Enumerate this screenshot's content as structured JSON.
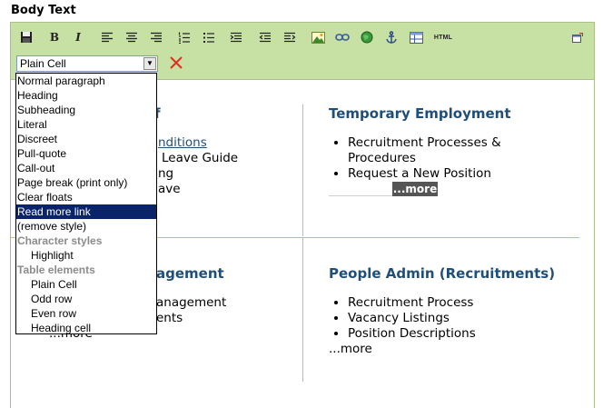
{
  "field_label": "Body Text",
  "toolbar": {
    "buttons": [
      "save-icon",
      "bold",
      "italic",
      "align-left-icon",
      "align-center-icon",
      "align-right-icon",
      "numbered-list-icon",
      "bulleted-list-icon",
      "outdent-icon",
      "indent-left-icon",
      "indent-right-icon",
      "insert-image-icon",
      "link-icon",
      "web-link-icon",
      "anchor-icon",
      "table-icon",
      "html-source",
      "maximize-icon"
    ],
    "bold_label": "B",
    "italic_label": "I",
    "html_label": "HTML",
    "style_select_value": "Plain Cell"
  },
  "dropdown": {
    "options": [
      {
        "label": "Normal paragraph",
        "kind": "item"
      },
      {
        "label": "Heading",
        "kind": "item"
      },
      {
        "label": "Subheading",
        "kind": "item"
      },
      {
        "label": "Literal",
        "kind": "item"
      },
      {
        "label": "Discreet",
        "kind": "item"
      },
      {
        "label": "Pull-quote",
        "kind": "item"
      },
      {
        "label": "Call-out",
        "kind": "item"
      },
      {
        "label": "Page break (print only)",
        "kind": "item"
      },
      {
        "label": "Clear floats",
        "kind": "item"
      },
      {
        "label": "Read more link",
        "kind": "item",
        "selected": true
      },
      {
        "label": "(remove style)",
        "kind": "item"
      },
      {
        "label": "Character styles",
        "kind": "group"
      },
      {
        "label": "Highlight",
        "kind": "item",
        "indent": true
      },
      {
        "label": "Table elements",
        "kind": "group"
      },
      {
        "label": "Plain Cell",
        "kind": "item",
        "indent": true
      },
      {
        "label": "Odd row",
        "kind": "item",
        "indent": true
      },
      {
        "label": "Even row",
        "kind": "item",
        "indent": true
      },
      {
        "label": "Heading cell",
        "kind": "item",
        "indent": true
      }
    ]
  },
  "content": {
    "left_top": {
      "title_fragment": "f",
      "line1": "nditions",
      "line2": "Leave Guide",
      "line3": "ng",
      "line4": "ave"
    },
    "right_top": {
      "title": "Temporary Employment",
      "items": [
        "Recruitment Processes &",
        "Procedures",
        "Request a New Position"
      ],
      "more": "...more"
    },
    "left_bottom": {
      "title_fragment": "agement",
      "line1": "anagement",
      "line2": "ents",
      "more_fragment": "...more"
    },
    "right_bottom": {
      "title": "People Admin (Recruitments)",
      "items": [
        "Recruitment Process",
        "Vacancy Listings",
        "Position Descriptions"
      ],
      "more": "...more"
    }
  },
  "colors": {
    "toolbar_bg": "#c7e0a4",
    "heading": "#1f4e79",
    "divider": "#d8b870",
    "selected_bg": "#0a246a"
  }
}
